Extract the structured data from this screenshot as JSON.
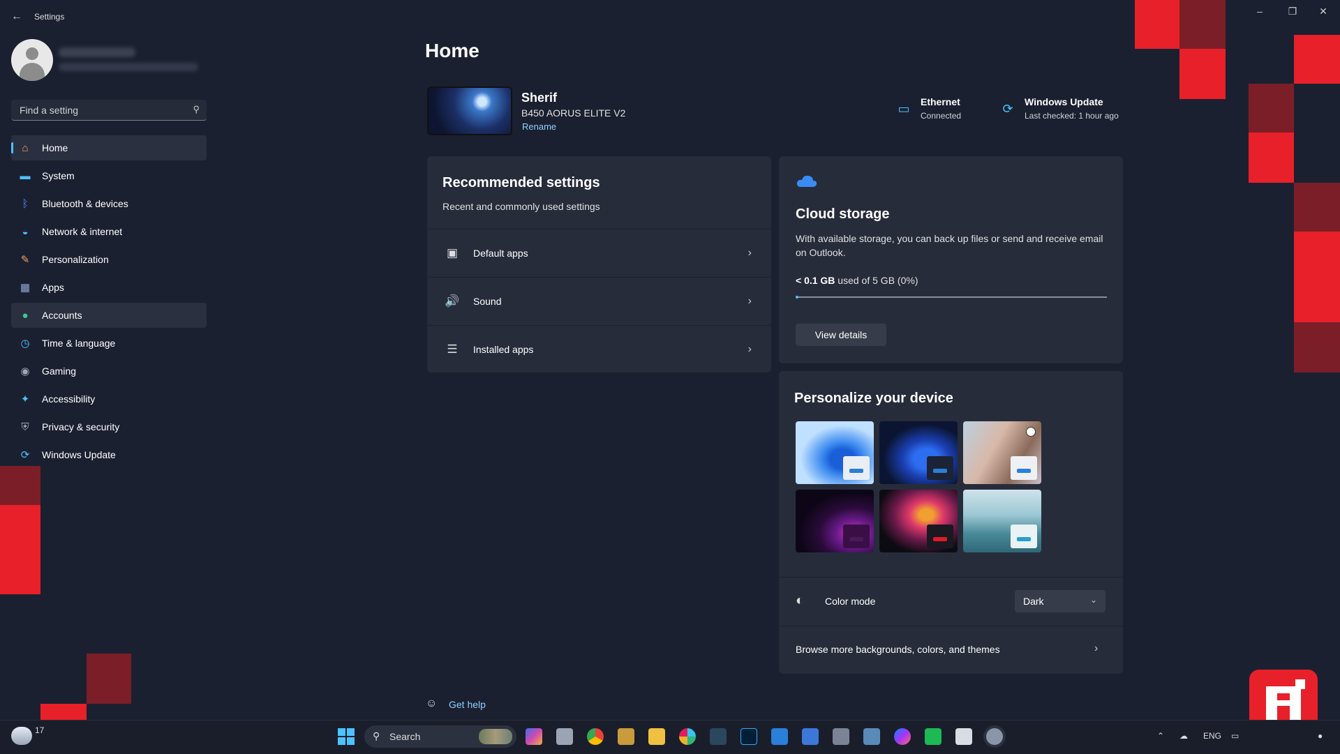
{
  "window": {
    "title": "Settings",
    "controls": {
      "minimize": "–",
      "restore": "❐",
      "close": "✕"
    }
  },
  "sidebar": {
    "search_placeholder": "Find a setting",
    "items": [
      {
        "label": "Home",
        "icon": "home-icon",
        "glyph": "⌂",
        "color": "#f7a35c"
      },
      {
        "label": "System",
        "icon": "monitor-icon",
        "glyph": "▬",
        "color": "#4cc2ff"
      },
      {
        "label": "Bluetooth & devices",
        "icon": "bluetooth-icon",
        "glyph": "ᛒ",
        "color": "#4c8dff"
      },
      {
        "label": "Network & internet",
        "icon": "wifi-icon",
        "glyph": "◒",
        "color": "#4cc2ff"
      },
      {
        "label": "Personalization",
        "icon": "brush-icon",
        "glyph": "✎",
        "color": "#f0a070"
      },
      {
        "label": "Apps",
        "icon": "apps-icon",
        "glyph": "▦",
        "color": "#8fa8d8"
      },
      {
        "label": "Accounts",
        "icon": "person-icon",
        "glyph": "●",
        "color": "#3ccb8a"
      },
      {
        "label": "Time & language",
        "icon": "globe-clock-icon",
        "glyph": "◷",
        "color": "#4cc2ff"
      },
      {
        "label": "Gaming",
        "icon": "controller-icon",
        "glyph": "◉",
        "color": "#a0a8b8"
      },
      {
        "label": "Accessibility",
        "icon": "accessibility-icon",
        "glyph": "✦",
        "color": "#4cc2ff"
      },
      {
        "label": "Privacy & security",
        "icon": "shield-icon",
        "glyph": "⛨",
        "color": "#a0a8b8"
      },
      {
        "label": "Windows Update",
        "icon": "update-icon",
        "glyph": "⟳",
        "color": "#4cc2ff"
      }
    ]
  },
  "main": {
    "page_title": "Home",
    "device": {
      "name": "Sherif",
      "model": "B450 AORUS ELITE V2",
      "rename": "Rename"
    },
    "status": [
      {
        "title": "Ethernet",
        "subtitle": "Connected",
        "icon": "ethernet-icon"
      },
      {
        "title": "Windows Update",
        "subtitle": "Last checked: 1 hour ago",
        "icon": "update-icon"
      }
    ],
    "recommended": {
      "title": "Recommended settings",
      "subtitle": "Recent and commonly used settings",
      "rows": [
        {
          "label": "Default apps",
          "icon": "default-apps-icon",
          "glyph": "▣"
        },
        {
          "label": "Sound",
          "icon": "speaker-icon",
          "glyph": "🔊"
        },
        {
          "label": "Installed apps",
          "icon": "list-icon",
          "glyph": "☰"
        }
      ]
    },
    "cloud": {
      "title": "Cloud storage",
      "description": "With available storage, you can back up files or send and receive email on Outlook.",
      "usage_strong": "< 0.1 GB",
      "usage_rest": " used of 5 GB (0%)",
      "usage_fraction": 0.01,
      "button": "View details"
    },
    "personalize": {
      "title": "Personalize your device",
      "color_mode_label": "Color mode",
      "color_mode_value": "Dark",
      "browse": "Browse more backgrounds, colors, and themes"
    },
    "get_help": "Get help"
  },
  "taskbar": {
    "search_label": "Search",
    "weather_temp": "17",
    "language": "ENG"
  },
  "colors": {
    "accent": "#4cc2ff",
    "background": "#1b2030",
    "card": "#272c3b",
    "deco_red": "#e8202a",
    "deco_dark_red": "#7c1e28"
  }
}
